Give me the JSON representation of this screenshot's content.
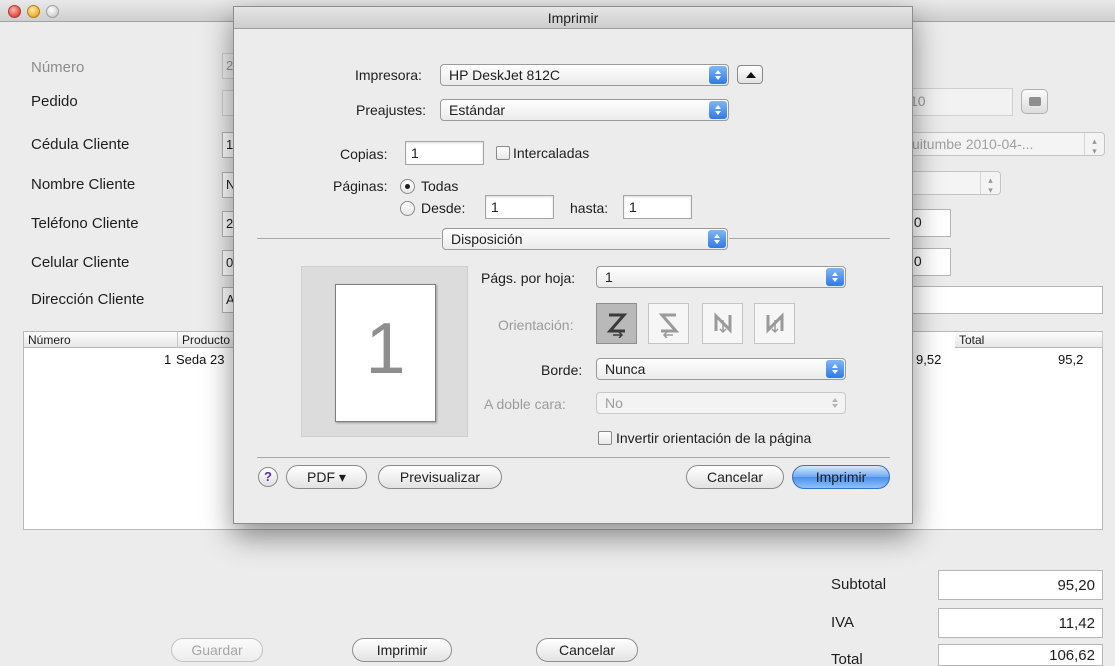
{
  "form": {
    "numero_label": "Número",
    "pedido_label": "Pedido",
    "cedula_label": "Cédula Cliente",
    "nombre_label": "Nombre Cliente",
    "telefono_label": "Teléfono Cliente",
    "celular_label": "Celular Cliente",
    "direccion_label": "Dirección Cliente",
    "numero_value": "2",
    "cedula_value": "1",
    "nombre_value": "N",
    "telefono_value": "2",
    "celular_value": "0",
    "direccion_value": "A",
    "right_pedido_value": "10",
    "right_cedula_value": "uitumbe 2010-04-...",
    "right_telefono_value": ".0",
    "right_celular_value": ".0"
  },
  "table": {
    "headers": [
      "Número",
      "Producto",
      "Total"
    ],
    "rows": [
      {
        "numero": "1",
        "producto": "Seda 23",
        "precio": "9,52",
        "total": "95,2"
      }
    ]
  },
  "totals": {
    "subtotal_label": "Subtotal",
    "subtotal_value": "95,20",
    "iva_label": "IVA",
    "iva_value": "11,42",
    "total_label": "Total",
    "total_value": "106,62"
  },
  "buttons": {
    "guardar": "Guardar",
    "imprimir": "Imprimir",
    "cancelar": "Cancelar"
  },
  "print_dialog": {
    "title": "Imprimir",
    "printer_label": "Impresora:",
    "printer_value": "HP DeskJet 812C",
    "presets_label": "Preajustes:",
    "presets_value": "Estándar",
    "copies_label": "Copias:",
    "copies_value": "1",
    "collated_label": "Intercaladas",
    "pages_label": "Páginas:",
    "pages_all_label": "Todas",
    "pages_from_label": "Desde:",
    "pages_from_value": "1",
    "pages_to_label": "hasta:",
    "pages_to_value": "1",
    "section_value": "Disposición",
    "pages_per_sheet_label": "Págs. por hoja:",
    "pages_per_sheet_value": "1",
    "orientation_label": "Orientación:",
    "border_label": "Borde:",
    "border_value": "Nunca",
    "two_sided_label": "A doble cara:",
    "two_sided_value": "No",
    "reverse_label": "Invertir orientación de la página",
    "preview_page_number": "1",
    "help_label": "?",
    "pdf_label": "PDF ▾",
    "preview_button": "Previsualizar",
    "cancel_button": "Cancelar",
    "print_button": "Imprimir"
  }
}
